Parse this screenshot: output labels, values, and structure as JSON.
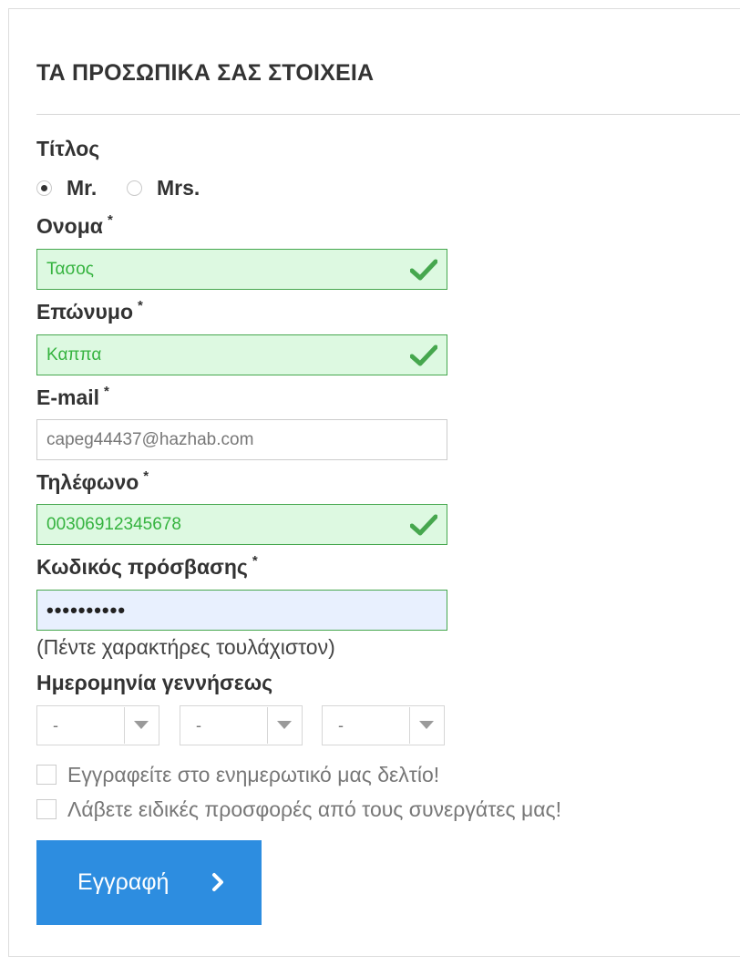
{
  "section": {
    "title": "ΤΑ ΠΡΟΣΩΠΙΚΑ ΣΑΣ ΣΤΟΙΧΕΙΑ"
  },
  "title_field": {
    "label": "Τίτλος",
    "options": [
      {
        "label": "Mr.",
        "checked": true
      },
      {
        "label": "Mrs.",
        "checked": false
      }
    ]
  },
  "first_name": {
    "label": "Ονομα",
    "required_mark": "*",
    "value": "Τασος",
    "valid": true
  },
  "last_name": {
    "label": "Επώνυμο",
    "required_mark": "*",
    "value": "Καππα",
    "valid": true
  },
  "email": {
    "label": "E-mail",
    "required_mark": "*",
    "value": "capeg44437@hazhab.com"
  },
  "phone": {
    "label": "Τηλέφωνο",
    "required_mark": "*",
    "value": "00306912345678",
    "valid": true
  },
  "password": {
    "label": "Κωδικός πρόσβασης",
    "required_mark": "*",
    "value": "••••••••••",
    "hint": "(Πέντε χαρακτήρες τουλάχιστον)"
  },
  "birthdate": {
    "label": "Ημερομηνία γεννήσεως",
    "day": "-",
    "month": "-",
    "year": "-"
  },
  "newsletter": {
    "label": "Εγγραφείτε στο ενημερωτικό μας δελτίο!",
    "checked": false
  },
  "offers": {
    "label": "Λάβετε ειδικές προσφορές από τους συνεργάτες μας!",
    "checked": false
  },
  "submit": {
    "label": "Εγγραφή",
    "icon": "chevron-right-icon"
  },
  "colors": {
    "valid_border": "#46a74e",
    "valid_bg": "#ddf9e1",
    "valid_text": "#35b33f",
    "autofill_bg": "#e8f0fe",
    "button_bg": "#2d8de0"
  }
}
